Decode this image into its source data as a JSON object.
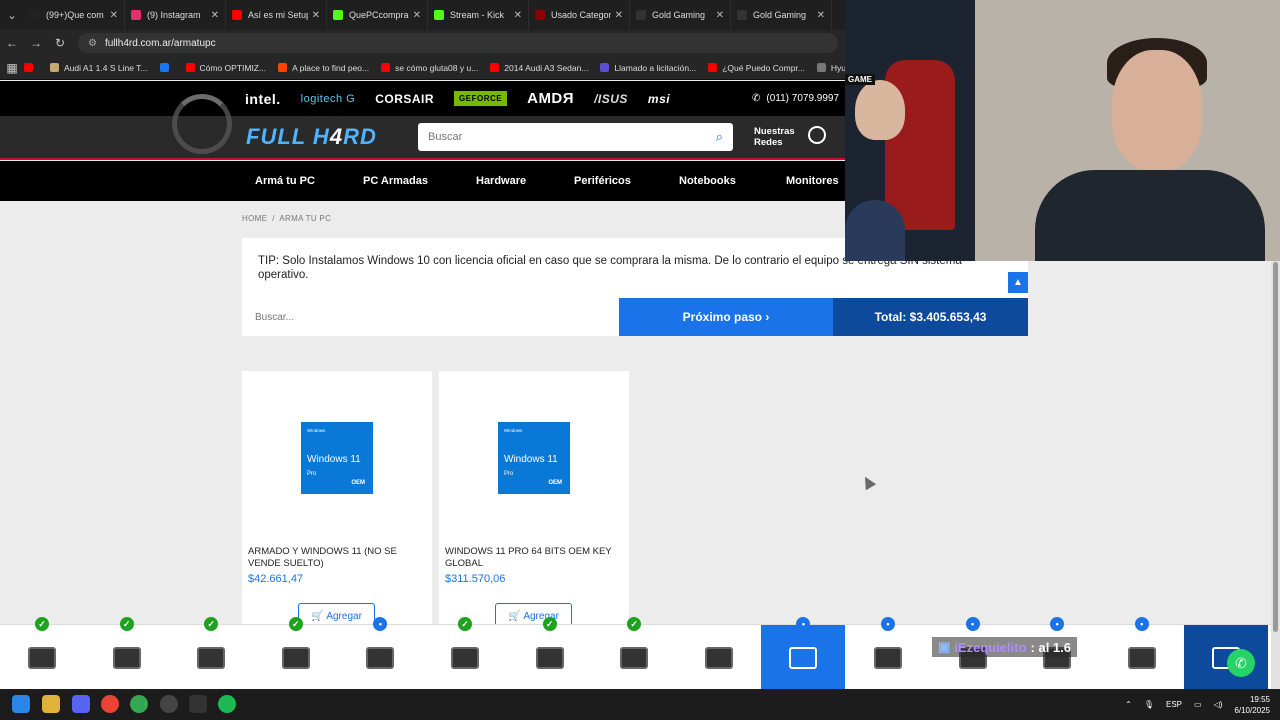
{
  "browser": {
    "tabs": [
      {
        "label": "(99+)Que com",
        "color": "#222"
      },
      {
        "label": "(9) Instagram",
        "color": "#e1306c"
      },
      {
        "label": "Así es mi Setup",
        "color": "#ff0000"
      },
      {
        "label": "QuePCcompra",
        "color": "#53fc18"
      },
      {
        "label": "Stream - Kick",
        "color": "#53fc18"
      },
      {
        "label": "Usado Categori",
        "color": "#8b0000"
      },
      {
        "label": "Gold Gaming",
        "color": "#333"
      },
      {
        "label": "Gold Gaming",
        "color": "#333"
      }
    ],
    "url": "fullh4rd.com.ar/armatupc",
    "bookmarks": [
      {
        "label": "",
        "color": "#ff0000"
      },
      {
        "label": "Audi A1 1.4 S Line T...",
        "color": "#c9a96e"
      },
      {
        "label": "",
        "color": "#1877f2"
      },
      {
        "label": "Cómo OPTIMIZ...",
        "color": "#ff0000"
      },
      {
        "label": "A place to find peo...",
        "color": "#ff4500"
      },
      {
        "label": "se cómo gluta08 y u...",
        "color": "#ff0000"
      },
      {
        "label": "2014 Audi A3 Sedan...",
        "color": "#ff0000"
      },
      {
        "label": "Llamado a licitación...",
        "color": "#5a4fcf"
      },
      {
        "label": "¿Qué Puedo Compr...",
        "color": "#ff0000"
      },
      {
        "label": "Hyundai",
        "color": "#777"
      }
    ]
  },
  "site": {
    "brands": [
      "intel.",
      "logitech G",
      "CORSAIR",
      "GEFORCE",
      "AMDЯ",
      "/ISUS",
      "msi"
    ],
    "phone": "(011) 7079.9997",
    "logo_main": "FULL H",
    "logo_accent": "4",
    "logo_end": "RD",
    "search_placeholder": "Buscar",
    "redes_line1": "Nuestras",
    "redes_line2": "Redes",
    "nav": [
      "Armá tu PC",
      "PC Armadas",
      "Hardware",
      "Periféricos",
      "Notebooks",
      "Monitores"
    ]
  },
  "page": {
    "breadcrumb_home": "HOME",
    "breadcrumb_sep": "/",
    "breadcrumb_current": "ARMA TU PC",
    "tip": "TIP: Solo Instalamos Windows 10 con licencia oficial en caso que se comprara la misma. De lo contrario el equipo se entrega SIN sistema operativo.",
    "filter_placeholder": "Buscar...",
    "next_step": "Próximo paso ›",
    "total": "Total: $3.405.653,43",
    "products": [
      {
        "title": "ARMADO Y WINDOWS 11 (NO SE VENDE SUELTO)",
        "price": "$42.661,47",
        "add": "Agregar",
        "box_top": "Windows",
        "box_name": "Windows 11",
        "box_edition": "Pro",
        "box_oem": "OEM"
      },
      {
        "title": "WINDOWS 11 PRO 64 BITS OEM KEY GLOBAL",
        "price": "$311.570,06",
        "add": "Agregar",
        "box_top": "Windows",
        "box_name": "Windows 11",
        "box_edition": "Pro",
        "box_oem": "OEM"
      }
    ]
  },
  "buildbar": {
    "slots": [
      {
        "name": "cpu",
        "status": "ok"
      },
      {
        "name": "cooler",
        "status": "ok"
      },
      {
        "name": "motherboard",
        "status": "ok"
      },
      {
        "name": "ram",
        "status": "ok"
      },
      {
        "name": "storage",
        "status": "pending"
      },
      {
        "name": "ssd",
        "status": "ok"
      },
      {
        "name": "gpu",
        "status": "ok"
      },
      {
        "name": "psu",
        "status": "ok"
      },
      {
        "name": "case",
        "status": "none"
      },
      {
        "name": "os",
        "status": "pending"
      },
      {
        "name": "mouse",
        "status": "pending"
      },
      {
        "name": "keyboard",
        "status": "pending"
      },
      {
        "name": "headset",
        "status": "pending"
      },
      {
        "name": "webcam",
        "status": "pending"
      },
      {
        "name": "monitor",
        "status": "none"
      }
    ],
    "chat_user": "iEzequielito",
    "chat_text": ": al 1.6"
  },
  "webcam": {
    "label": "GAME"
  },
  "taskbar": {
    "lang": "ESP",
    "time": "19:55",
    "date": "6/10/2025"
  }
}
